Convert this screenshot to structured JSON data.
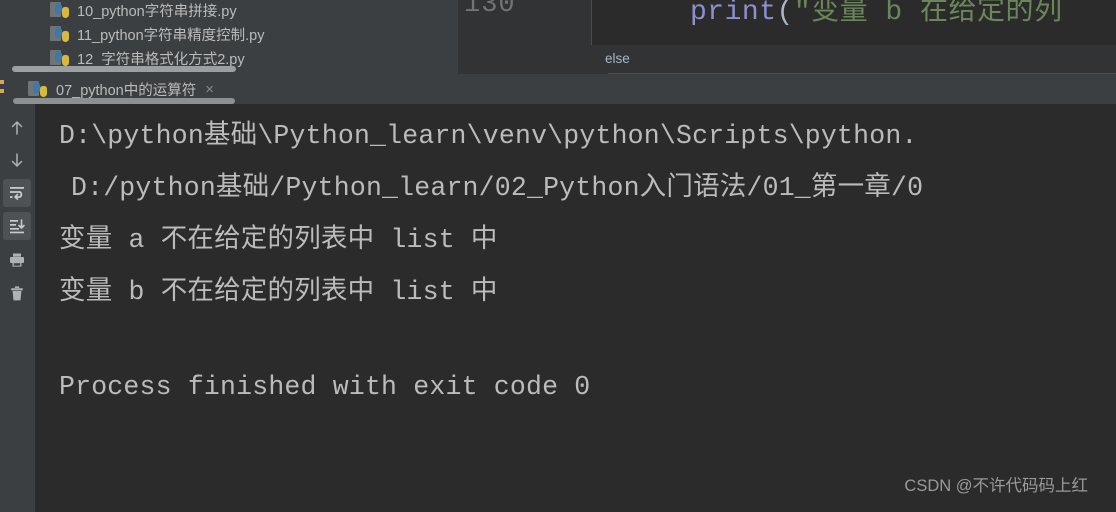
{
  "filetree": {
    "items": [
      {
        "label": "10_python字符串拼接.py",
        "icon": "python-file-icon"
      },
      {
        "label": "11_python字符串精度控制.py",
        "icon": "python-file-icon"
      },
      {
        "label": "12_字符串格式化方式2.py",
        "icon": "python-file-icon"
      }
    ]
  },
  "editor": {
    "line_number": "130",
    "code": {
      "func": "print",
      "open_paren": "(",
      "string": "\"变量 b 在给定的列"
    },
    "breadcrumb": "else"
  },
  "run_tab": {
    "label": "07_python中的运算符",
    "icon": "python-file-icon",
    "close": "×"
  },
  "toolbar": {
    "buttons": [
      {
        "name": "up-arrow-icon",
        "title": "Up the Stack Trace",
        "active": false
      },
      {
        "name": "down-arrow-icon",
        "title": "Down the Stack Trace",
        "active": false
      },
      {
        "name": "soft-wrap-icon",
        "title": "Soft-Wrap",
        "active": true
      },
      {
        "name": "scroll-to-end-icon",
        "title": "Scroll to End",
        "active": true
      },
      {
        "name": "print-icon",
        "title": "Print",
        "active": false
      },
      {
        "name": "trash-icon",
        "title": "Clear All",
        "active": false
      }
    ]
  },
  "console": {
    "lines": [
      {
        "text": "D:\\python基础\\Python_learn\\venv\\python\\Scripts\\python.",
        "indent": false
      },
      {
        "text": "D:/python基础/Python_learn/02_Python入门语法/01_第一章/0",
        "indent": true
      },
      {
        "text": "变量 a 不在给定的列表中 list 中",
        "indent": false
      },
      {
        "text": "变量 b 不在给定的列表中 list 中",
        "indent": false
      },
      {
        "text": "Process finished with exit code 0",
        "indent": false
      }
    ],
    "watermark": "CSDN @不许代码码上红"
  },
  "colors": {
    "console_bg": "#2b2b2b",
    "panel_bg": "#3c3f41",
    "gutter_bg": "#313335",
    "text": "#bbbbbb",
    "string_green": "#6a8759",
    "keyword_purple": "#8f8fd0",
    "line_number": "#707477"
  }
}
